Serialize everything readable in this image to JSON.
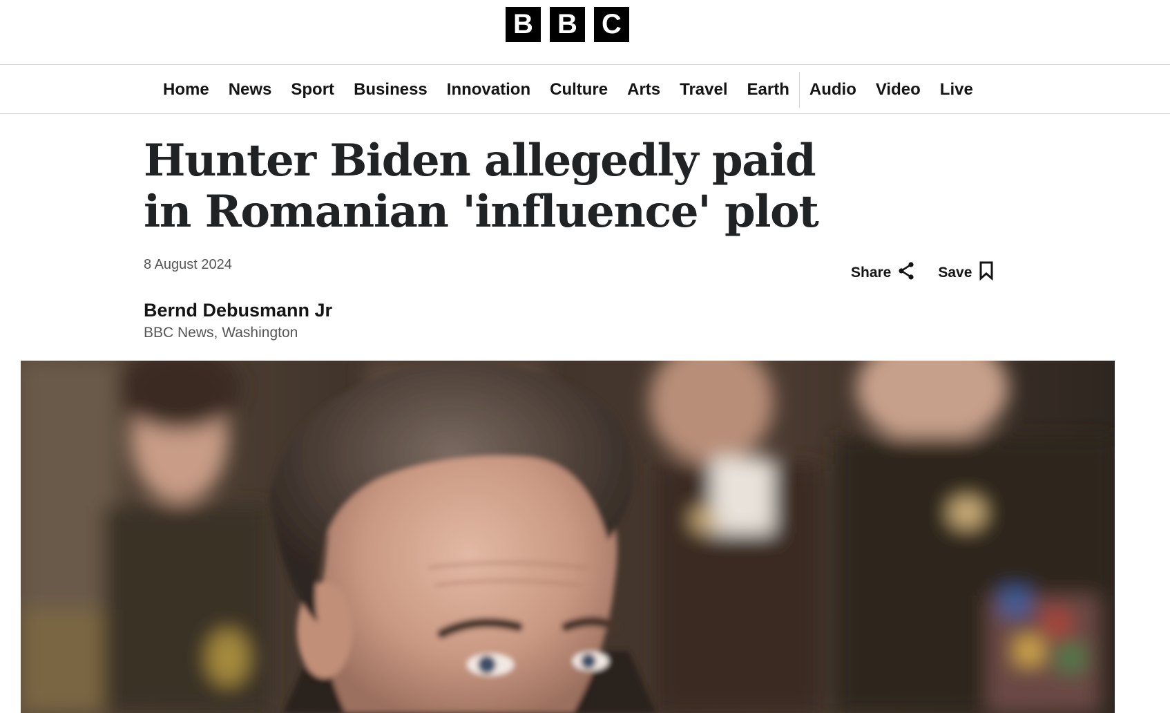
{
  "logo": {
    "letters": [
      "B",
      "B",
      "C"
    ]
  },
  "nav": {
    "primary": [
      "Home",
      "News",
      "Sport",
      "Business",
      "Innovation",
      "Culture",
      "Arts",
      "Travel",
      "Earth"
    ],
    "secondary": [
      "Audio",
      "Video",
      "Live"
    ]
  },
  "article": {
    "headline": "Hunter Biden allegedly paid in Romanian 'influence' plot",
    "date": "8 August 2024",
    "share_label": "Share",
    "save_label": "Save",
    "author": "Bernd Debusmann Jr",
    "author_org": "BBC News, Washington"
  },
  "icons": {
    "share": "share-icon",
    "save": "bookmark-icon"
  },
  "colors": {
    "logo_bg": "#000000",
    "text": "#141414",
    "headline": "#202224",
    "meta": "#545658",
    "divider": "#d4d4d4"
  }
}
